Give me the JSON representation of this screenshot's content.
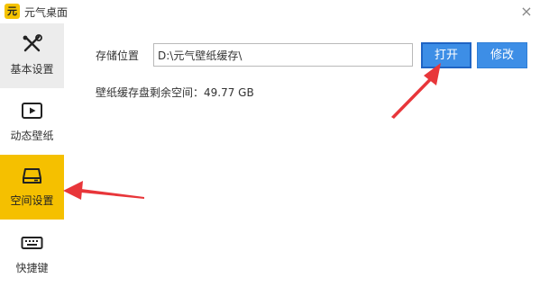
{
  "window": {
    "logo_text": "元",
    "title": "元气桌面",
    "close_glyph": "×"
  },
  "sidebar": {
    "items": [
      {
        "label": "基本设置",
        "icon": "tools-icon",
        "state": "inactive"
      },
      {
        "label": "动态壁纸",
        "icon": "play-icon",
        "state": "inactive"
      },
      {
        "label": "空间设置",
        "icon": "drive-icon",
        "state": "active"
      },
      {
        "label": "快捷键",
        "icon": "keyboard-icon",
        "state": "inactive"
      }
    ]
  },
  "storage": {
    "location_label": "存储位置",
    "path_value": "D:\\元气壁纸缓存\\",
    "open_button": "打开",
    "modify_button": "修改",
    "free_space_text": "壁纸缓存盘剩余空间：49.77 GB"
  },
  "colors": {
    "accent_yellow": "#f5c000",
    "button_blue": "#3d8ee6",
    "annotation_arrow": "#e8363a"
  }
}
